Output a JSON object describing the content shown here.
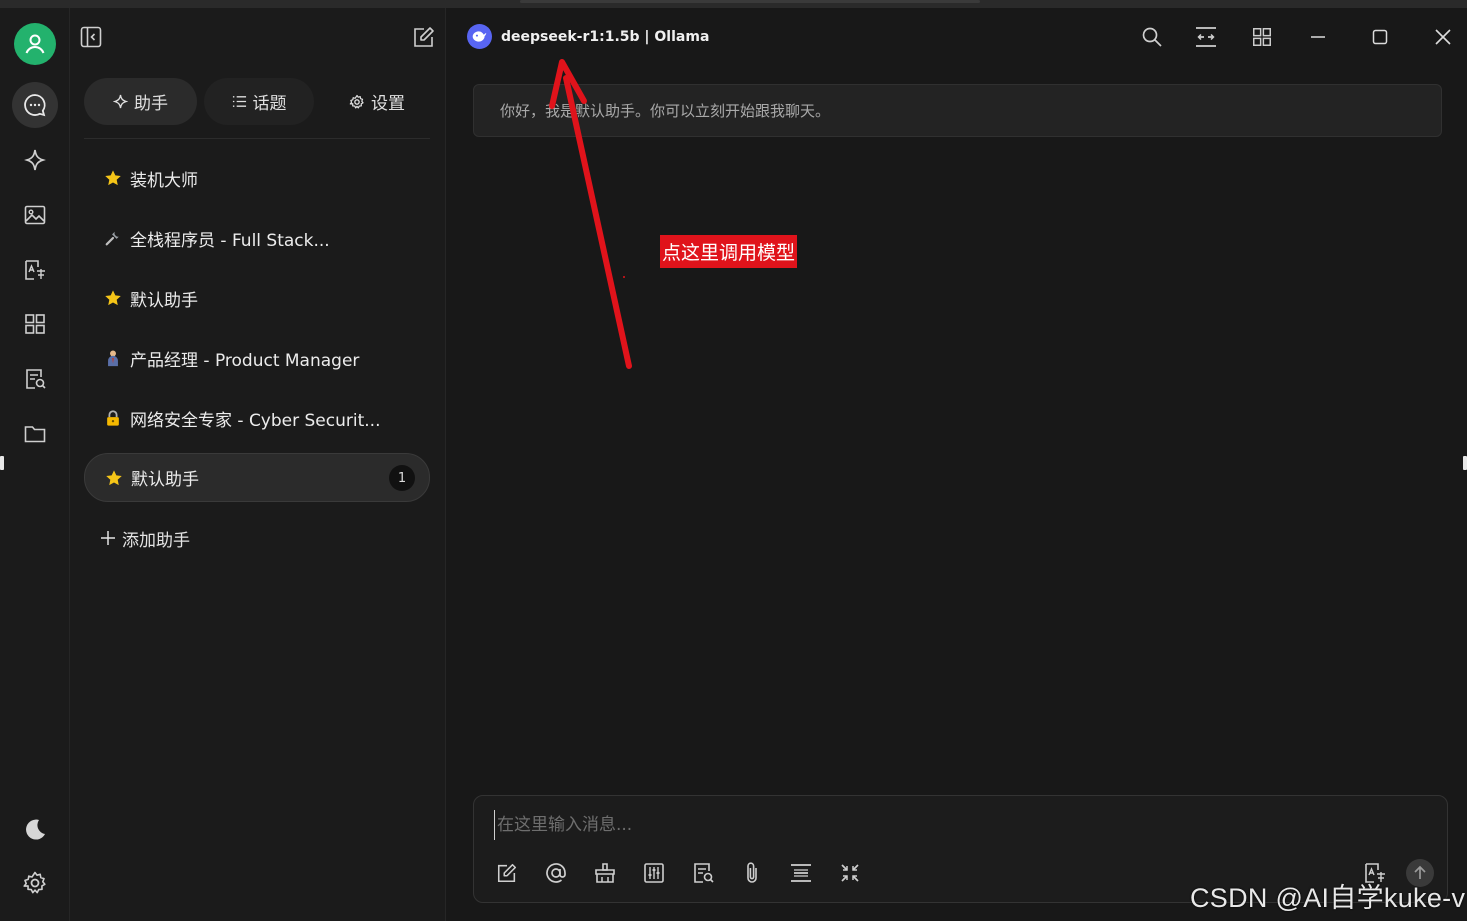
{
  "model_selector": {
    "label": "deepseek-r1:1.5b | Ollama"
  },
  "side_tabs": [
    {
      "label": "助手"
    },
    {
      "label": "话题"
    },
    {
      "label": "设置"
    }
  ],
  "assistants": [
    {
      "label": "装机大师",
      "icon": "star-icon"
    },
    {
      "label": "全栈程序员 - Full Stack...",
      "icon": "wrench-icon"
    },
    {
      "label": "默认助手",
      "icon": "star-icon"
    },
    {
      "label": "产品经理 - Product Manager",
      "icon": "person-icon"
    },
    {
      "label": "网络安全专家 - Cyber Securit...",
      "icon": "lock-icon"
    },
    {
      "label": "默认助手",
      "icon": "star-icon",
      "badge": "1",
      "active": true
    }
  ],
  "add_assistant": {
    "label": "添加助手"
  },
  "greeting": "你好，我是默认助手。你可以立刻开始跟我聊天。",
  "annotation": "点这里调用模型",
  "input": {
    "placeholder": "在这里输入消息..."
  },
  "watermark": "CSDN @AI自学kuke-v",
  "colors": {
    "accent_green": "#23b26d",
    "annotation_red": "#e0131b",
    "model_logo": "#5865f2"
  }
}
